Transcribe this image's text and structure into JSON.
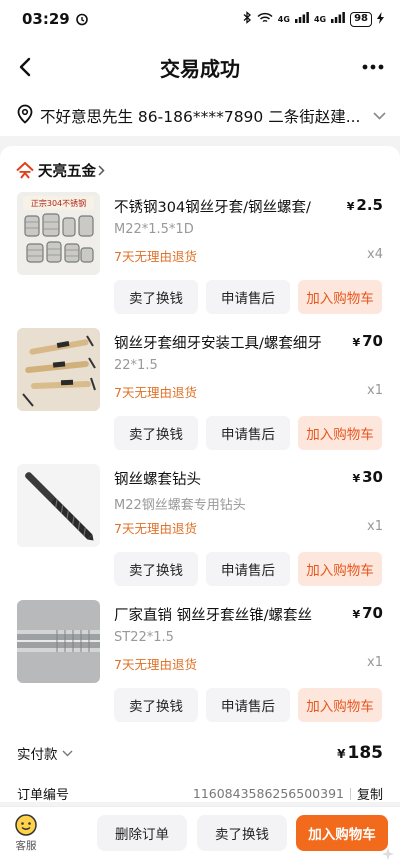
{
  "status_bar": {
    "time": "03:29",
    "battery": "98",
    "network_label": "4G"
  },
  "nav": {
    "title": "交易成功",
    "back_icon": "chevron-left-icon",
    "more_icon": "more-dots-icon"
  },
  "address": {
    "text": "不好意思先生  86-186****7890  二条街赵建..."
  },
  "shop": {
    "name": "天亮五金"
  },
  "products": [
    {
      "title": "不锈钢304钢丝牙套/钢丝螺套/",
      "price": "2.5",
      "spec": "M22*1.5*1D",
      "return_policy": "7天无理由退货",
      "quantity": "x4",
      "thumb_text": "正宗304不锈钢",
      "buttons": {
        "sell": "卖了换钱",
        "after_sale": "申请售后",
        "add_cart": "加入购物车"
      }
    },
    {
      "title": "钢丝牙套细牙安装工具/螺套细牙",
      "price": "70",
      "spec": "22*1.5",
      "return_policy": "7天无理由退货",
      "quantity": "x1",
      "buttons": {
        "sell": "卖了换钱",
        "after_sale": "申请售后",
        "add_cart": "加入购物车"
      }
    },
    {
      "title": "钢丝螺套钻头",
      "price": "30",
      "spec": "M22钢丝螺套专用钻头",
      "return_policy": "7天无理由退货",
      "quantity": "x1",
      "buttons": {
        "sell": "卖了换钱",
        "after_sale": "申请售后",
        "add_cart": "加入购物车"
      }
    },
    {
      "title": "厂家直销 钢丝牙套丝锥/螺套丝",
      "price": "70",
      "spec": "ST22*1.5",
      "return_policy": "7天无理由退货",
      "quantity": "x1",
      "buttons": {
        "sell": "卖了换钱",
        "after_sale": "申请售后",
        "add_cart": "加入购物车"
      }
    }
  ],
  "currency": "¥",
  "payment": {
    "label": "实付款",
    "amount": "185"
  },
  "order": {
    "label": "订单编号",
    "number": "1160843586256500391",
    "copy": "复制"
  },
  "bottom_bar": {
    "kefu_label": "客服",
    "delete": "删除订单",
    "sell": "卖了换钱",
    "add_cart": "加入购物车"
  },
  "colors": {
    "accent": "#f26a1b",
    "return_text": "#e0722a",
    "cart_button_bg": "#fde7dd",
    "shop_logo": "#e0401a"
  }
}
